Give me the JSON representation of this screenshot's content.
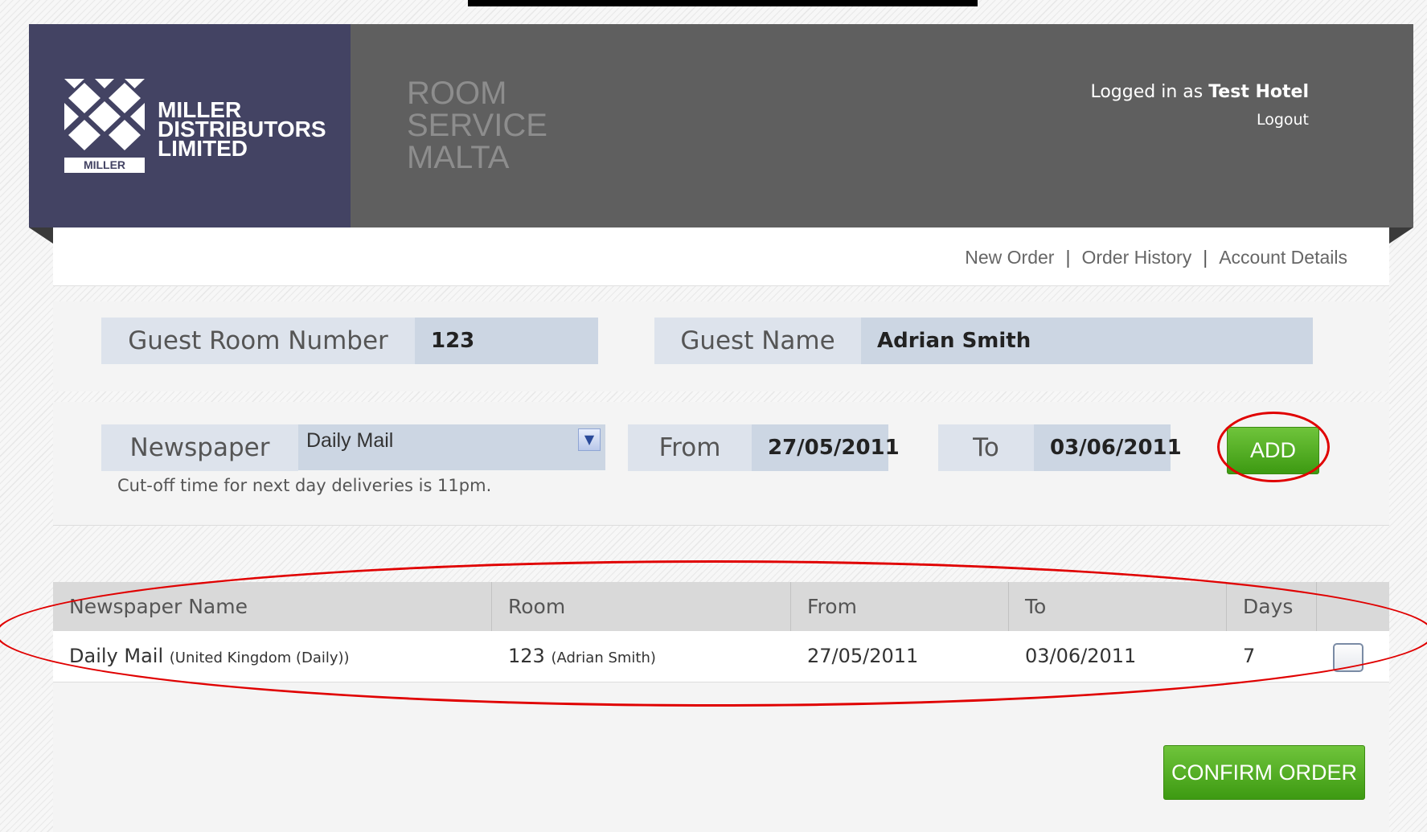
{
  "header": {
    "company_lines": [
      "MILLER",
      "DISTRIBUTORS",
      "LIMITED"
    ],
    "logo_badge": "MILLER",
    "product_lines": [
      "ROOM",
      "SERVICE",
      "MALTA"
    ],
    "login_prefix": "Logged in as",
    "login_user": "Test Hotel",
    "logout_label": "Logout"
  },
  "nav": {
    "items": [
      {
        "label": "New Order"
      },
      {
        "label": "Order History"
      },
      {
        "label": "Account Details"
      }
    ],
    "separator": "|"
  },
  "guest": {
    "room_label": "Guest Room Number",
    "room_value": "123",
    "name_label": "Guest Name",
    "name_value": "Adrian Smith"
  },
  "order_form": {
    "newspaper_label": "Newspaper",
    "newspaper_selected": "Daily Mail",
    "from_label": "From",
    "from_value": "27/05/2011",
    "to_label": "To",
    "to_value": "03/06/2011",
    "add_label": "ADD",
    "cutoff_note": "Cut-off time for next day deliveries is 11pm."
  },
  "table": {
    "columns": [
      "Newspaper Name",
      "Room",
      "From",
      "To",
      "Days"
    ],
    "rows": [
      {
        "newspaper": "Daily Mail",
        "newspaper_detail": "(United Kingdom (Daily))",
        "room": "123",
        "room_detail": "(Adrian Smith)",
        "from": "27/05/2011",
        "to": "03/06/2011",
        "days": "7",
        "checked": false
      }
    ]
  },
  "confirm_label": "CONFIRM ORDER",
  "colors": {
    "header_bg": "#5f5f5f",
    "logo_bg": "#434363",
    "accent_green": "#4aa81a",
    "annotation_red": "#e00000"
  }
}
